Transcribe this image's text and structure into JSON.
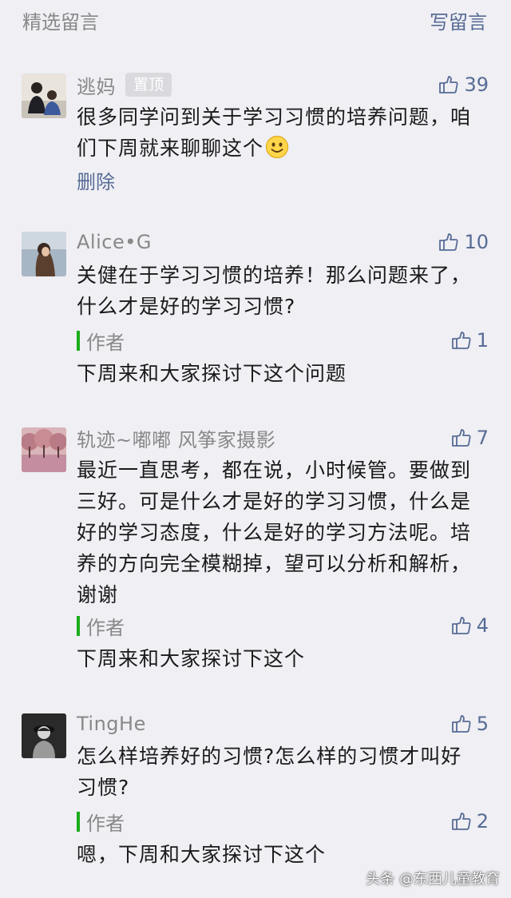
{
  "header": {
    "title": "精选留言",
    "write_label": "写留言"
  },
  "comments": [
    {
      "name": "逃妈",
      "badge": "置顶",
      "likes": "39",
      "text": "很多同学问到关于学习习惯的培养问题，咱们下周就来聊聊这个",
      "delete_label": "删除",
      "avatar_icon": "family-photo-avatar"
    },
    {
      "name": "Alice•G",
      "likes": "10",
      "text": "关健在于学习习惯的培养！那么问题来了，什么才是好的学习习惯?",
      "author_label": "作者",
      "author_likes": "1",
      "reply": "下周来和大家探讨下这个问题",
      "avatar_icon": "portrait-photo-avatar"
    },
    {
      "name": "轨迹~嘟嘟 风筝家摄影",
      "likes": "7",
      "text": "最近一直思考，都在说，小时候管。要做到三好。可是什么才是好的学习习惯，什么是好的学习态度，什么是好的学习方法呢。培养的方向完全模糊掉，望可以分析和解析，谢谢",
      "author_label": "作者",
      "author_likes": "4",
      "reply": "下周来和大家探讨下这个",
      "avatar_icon": "cherry-trees-avatar"
    },
    {
      "name": "TingHe",
      "likes": "5",
      "text": "怎么样培养好的习惯?怎么样的习惯才叫好习惯?",
      "author_label": "作者",
      "author_likes": "2",
      "reply": "嗯，下周和大家探讨下这个",
      "avatar_icon": "bw-portrait-avatar"
    }
  ],
  "watermark": "头条 @东西儿童教育",
  "colors": {
    "link": "#576b95",
    "muted": "#888888",
    "author_bar": "#1aad19",
    "background": "#efeff4"
  }
}
